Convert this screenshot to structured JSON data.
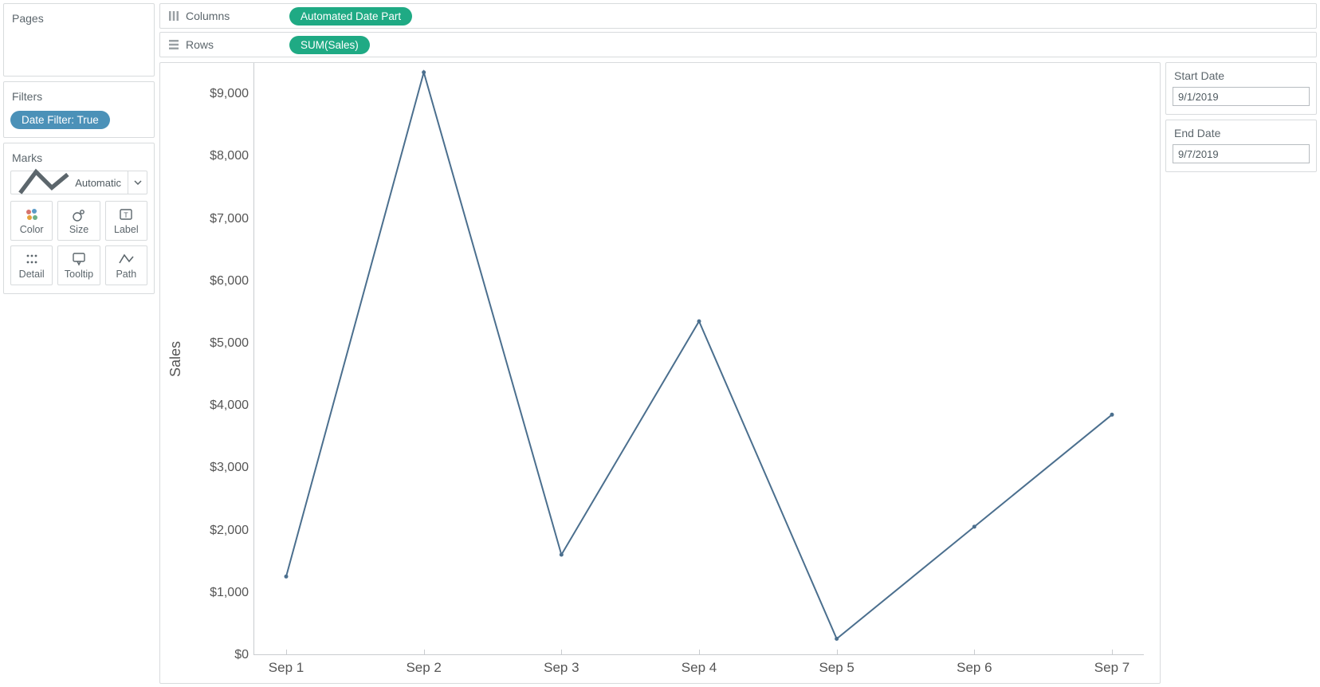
{
  "left": {
    "pages_title": "Pages",
    "filters_title": "Filters",
    "filter_pill": "Date Filter: True",
    "marks_title": "Marks",
    "marks_type": "Automatic",
    "mark_buttons": [
      "Color",
      "Size",
      "Label",
      "Detail",
      "Tooltip",
      "Path"
    ]
  },
  "shelves": {
    "columns_label": "Columns",
    "columns_pill": "Automated Date Part",
    "rows_label": "Rows",
    "rows_pill": "SUM(Sales)"
  },
  "right": {
    "start_label": "Start Date",
    "start_value": "9/1/2019",
    "end_label": "End Date",
    "end_value": "9/7/2019"
  },
  "chart_data": {
    "type": "line",
    "ylabel": "Sales",
    "ylim": [
      0,
      9500
    ],
    "y_ticks": [
      0,
      1000,
      2000,
      3000,
      4000,
      5000,
      6000,
      7000,
      8000,
      9000
    ],
    "y_tick_labels": [
      "$0",
      "$1,000",
      "$2,000",
      "$3,000",
      "$4,000",
      "$5,000",
      "$6,000",
      "$7,000",
      "$8,000",
      "$9,000"
    ],
    "categories": [
      "Sep 1",
      "Sep 2",
      "Sep 3",
      "Sep 4",
      "Sep 5",
      "Sep 6",
      "Sep 7"
    ],
    "values": [
      1250,
      9350,
      1600,
      5350,
      250,
      2050,
      3850
    ]
  }
}
